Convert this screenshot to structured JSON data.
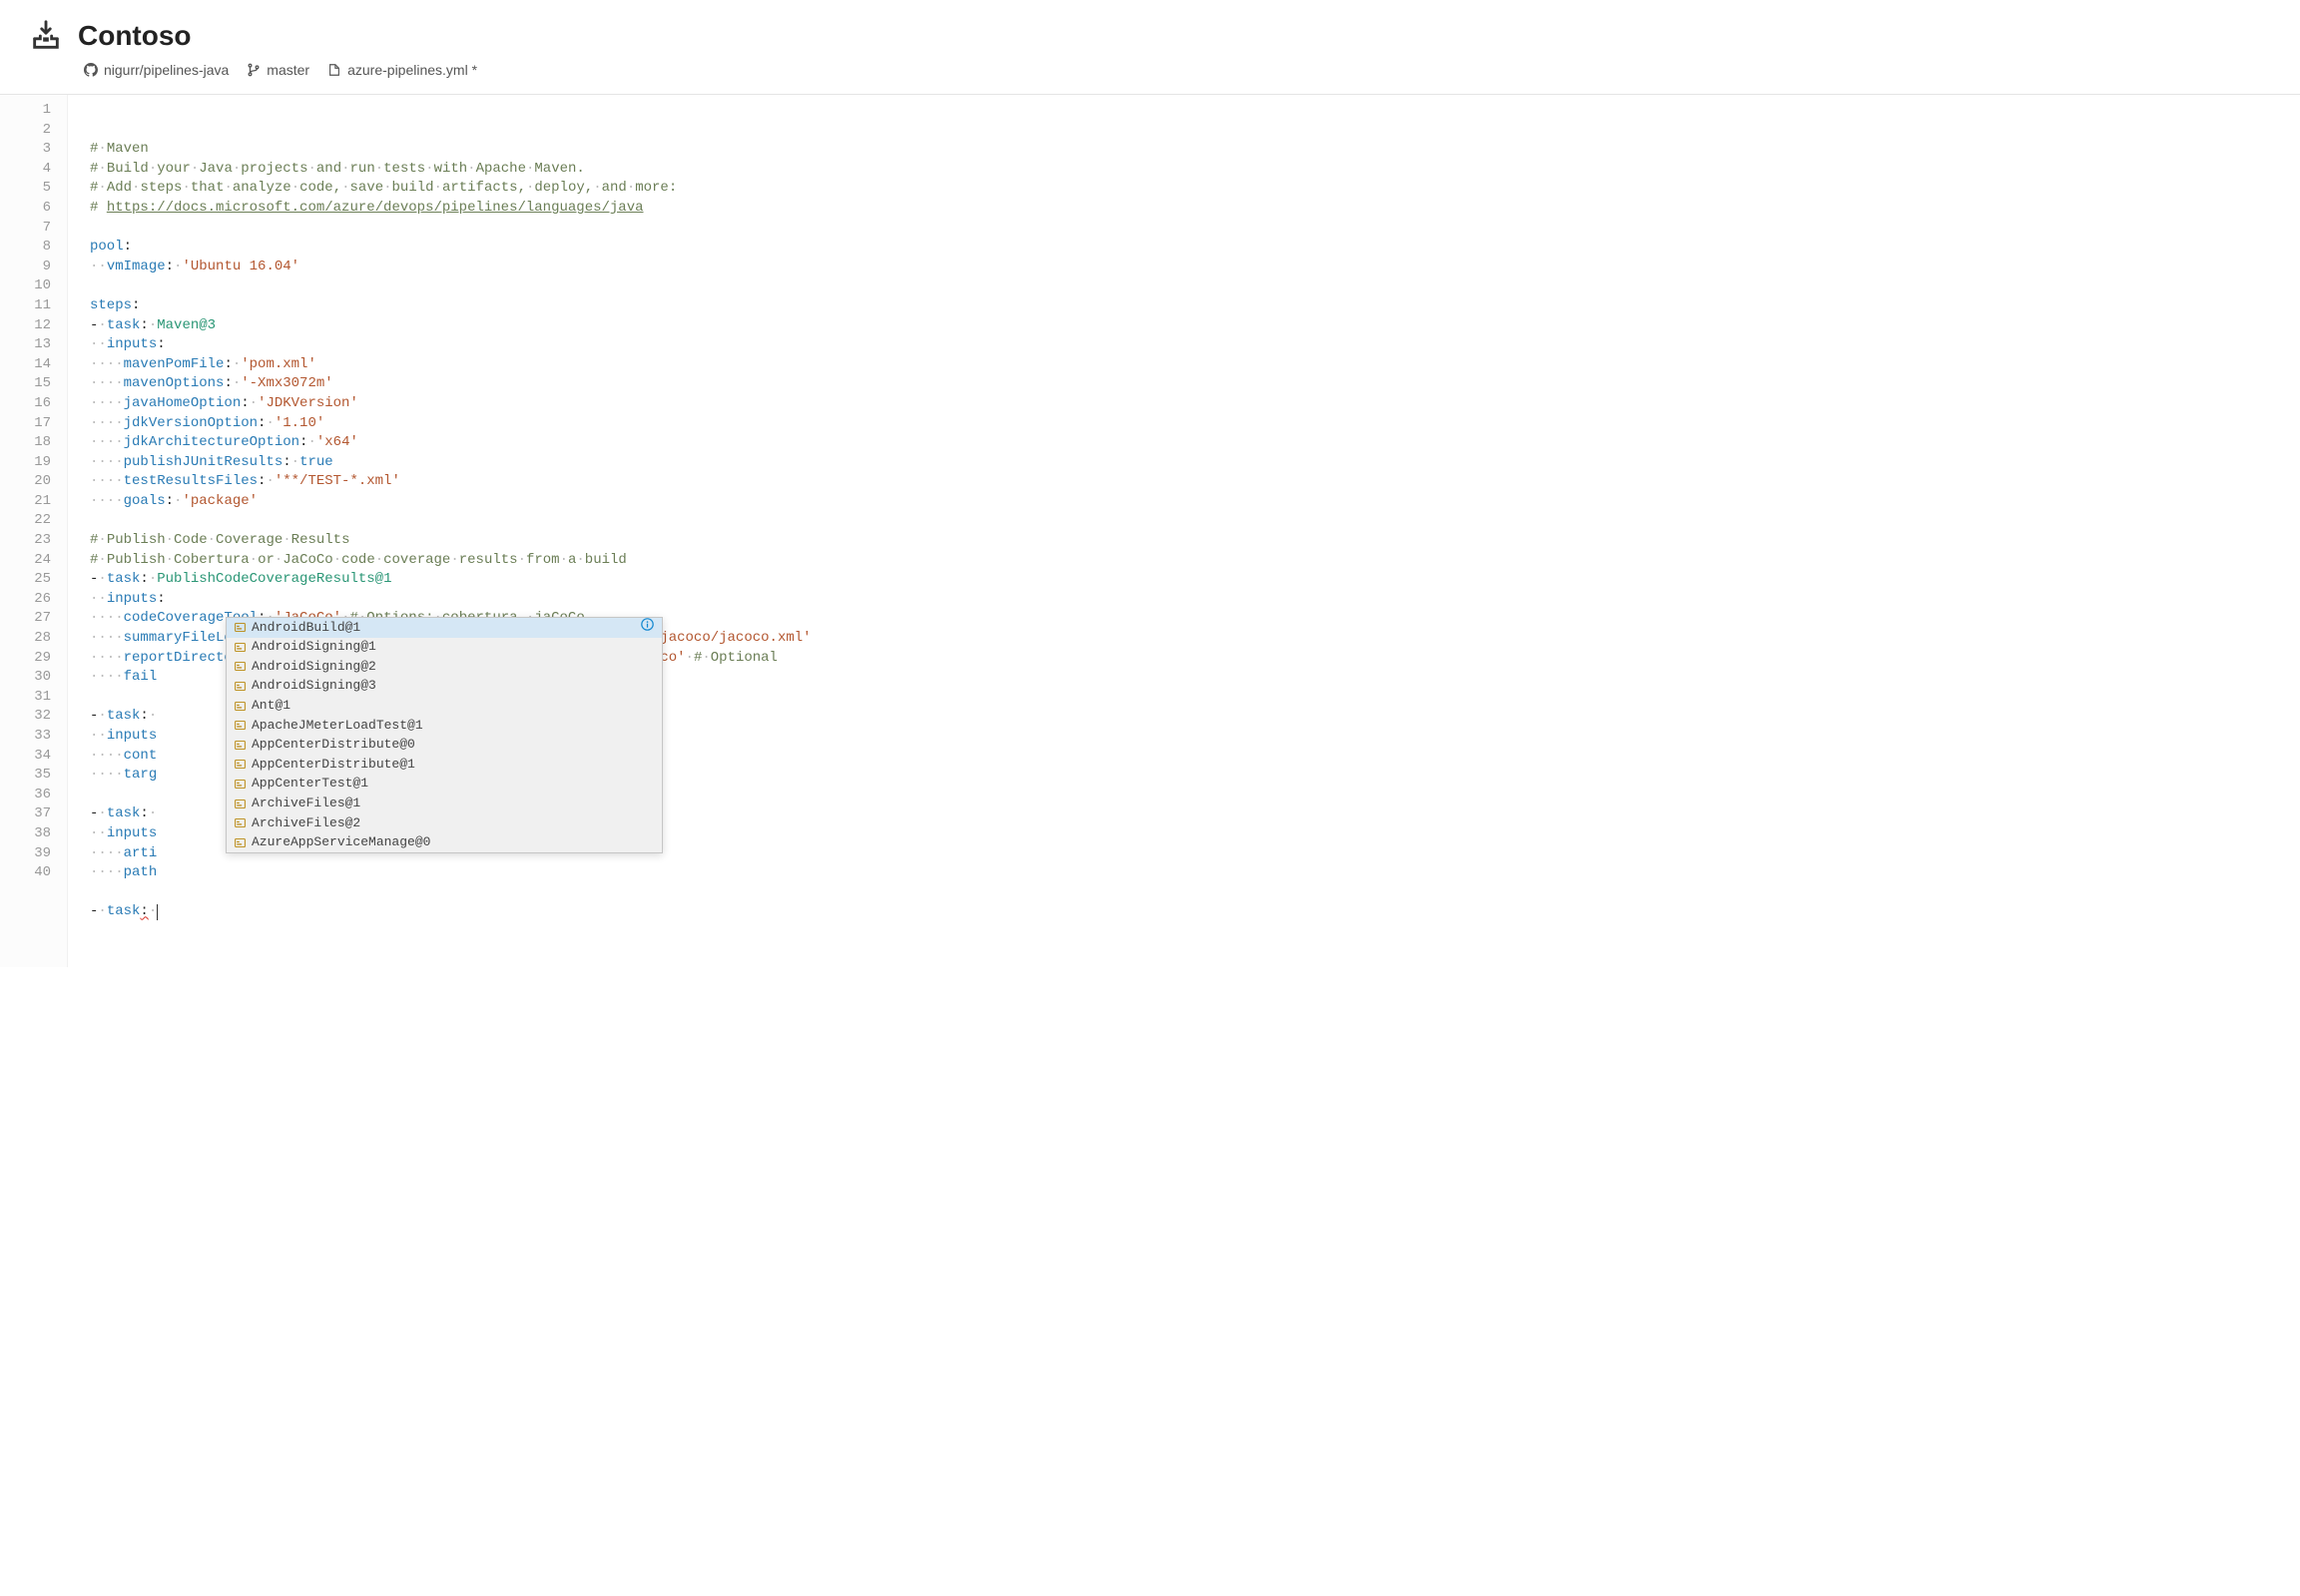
{
  "header": {
    "title": "Contoso"
  },
  "breadcrumb": {
    "repo": "nigurr/pipelines-java",
    "branch": "master",
    "file": "azure-pipelines.yml *"
  },
  "autocomplete": {
    "items": [
      "AndroidBuild@1",
      "AndroidSigning@1",
      "AndroidSigning@2",
      "AndroidSigning@3",
      "Ant@1",
      "ApacheJMeterLoadTest@1",
      "AppCenterDistribute@0",
      "AppCenterDistribute@1",
      "AppCenterTest@1",
      "ArchiveFiles@1",
      "ArchiveFiles@2",
      "AzureAppServiceManage@0"
    ],
    "selected_index": 0
  },
  "code": {
    "lines": [
      {
        "type": "comment",
        "text": "# Maven"
      },
      {
        "type": "comment",
        "text": "# Build your Java projects and run tests with Apache Maven."
      },
      {
        "type": "comment",
        "text": "# Add steps that analyze code, save build artifacts, deploy, and more:"
      },
      {
        "type": "link",
        "prefix": "# ",
        "url": "https://docs.microsoft.com/azure/devops/pipelines/languages/java"
      },
      {
        "type": "blank"
      },
      {
        "type": "key",
        "key": "pool",
        "colon": true
      },
      {
        "type": "kv",
        "indent": 2,
        "key": "vmImage",
        "value": "'Ubuntu 16.04'"
      },
      {
        "type": "blank"
      },
      {
        "type": "key",
        "key": "steps",
        "colon": true
      },
      {
        "type": "task",
        "indent": 0,
        "prefix": "- ",
        "key": "task",
        "value": "Maven@3"
      },
      {
        "type": "key",
        "indent": 2,
        "key": "inputs",
        "colon": true
      },
      {
        "type": "kv",
        "indent": 4,
        "key": "mavenPomFile",
        "value": "'pom.xml'"
      },
      {
        "type": "kv",
        "indent": 4,
        "key": "mavenOptions",
        "value": "'-Xmx3072m'"
      },
      {
        "type": "kv",
        "indent": 4,
        "key": "javaHomeOption",
        "value": "'JDKVersion'"
      },
      {
        "type": "kv",
        "indent": 4,
        "key": "jdkVersionOption",
        "value": "'1.10'"
      },
      {
        "type": "kv",
        "indent": 4,
        "key": "jdkArchitectureOption",
        "value": "'x64'"
      },
      {
        "type": "kvbool",
        "indent": 4,
        "key": "publishJUnitResults",
        "value": "true"
      },
      {
        "type": "kv",
        "indent": 4,
        "key": "testResultsFiles",
        "value": "'**/TEST-*.xml'"
      },
      {
        "type": "kv",
        "indent": 4,
        "key": "goals",
        "value": "'package'"
      },
      {
        "type": "blank"
      },
      {
        "type": "comment",
        "text": "# Publish Code Coverage Results"
      },
      {
        "type": "comment",
        "text": "# Publish Cobertura or JaCoCo code coverage results from a build"
      },
      {
        "type": "task",
        "indent": 0,
        "prefix": "- ",
        "key": "task",
        "value": "PublishCodeCoverageResults@1"
      },
      {
        "type": "key",
        "indent": 2,
        "key": "inputs",
        "colon": true
      },
      {
        "type": "kvcomment",
        "indent": 4,
        "key": "codeCoverageTool",
        "value": "'JaCoCo'",
        "comment": "# Options: cobertura, jaCoCo"
      },
      {
        "type": "kv",
        "indent": 4,
        "key": "summaryFileLocation",
        "value": "'$(System.DefaultWorkingDirectory)/**/site/jacoco/jacoco.xml'"
      },
      {
        "type": "kvcomment",
        "indent": 4,
        "key": "reportDirectory",
        "value": "'$(System.DefaultWorkingDirectory)/**/site/jacoco'",
        "comment": "# Optional"
      },
      {
        "type": "partial",
        "indent": 4,
        "key": "fail"
      },
      {
        "type": "blank"
      },
      {
        "type": "task",
        "indent": 0,
        "prefix": "- ",
        "key": "task",
        "value": ""
      },
      {
        "type": "partial",
        "indent": 2,
        "key": "inputs"
      },
      {
        "type": "partial",
        "indent": 4,
        "key": "cont"
      },
      {
        "type": "partial",
        "indent": 4,
        "key": "targ"
      },
      {
        "type": "blank"
      },
      {
        "type": "task",
        "indent": 0,
        "prefix": "- ",
        "key": "task",
        "value": ""
      },
      {
        "type": "partial",
        "indent": 2,
        "key": "inputs"
      },
      {
        "type": "partial",
        "indent": 4,
        "key": "arti"
      },
      {
        "type": "partial",
        "indent": 4,
        "key": "path"
      },
      {
        "type": "blank"
      },
      {
        "type": "taskerror",
        "indent": 0,
        "prefix": "- ",
        "key": "task",
        "value": ""
      }
    ]
  }
}
